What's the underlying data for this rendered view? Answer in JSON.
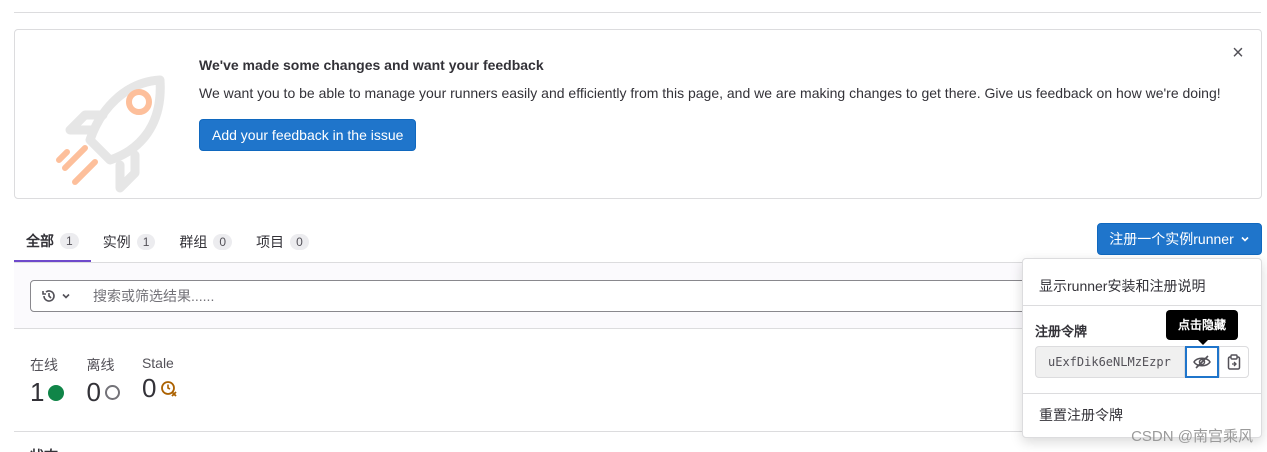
{
  "banner": {
    "title": "We've made some changes and want your feedback",
    "body": "We want you to be able to manage your runners easily and efficiently from this page, and we are making changes to get there. Give us feedback on how we're doing!",
    "button_label": "Add your feedback in the issue",
    "close_glyph": "×"
  },
  "tabs": [
    {
      "label": "全部",
      "count": "1"
    },
    {
      "label": "实例",
      "count": "1"
    },
    {
      "label": "群组",
      "count": "0"
    },
    {
      "label": "项目",
      "count": "0"
    }
  ],
  "register_button": {
    "label": "注册一个实例runner"
  },
  "search": {
    "placeholder": "搜索或筛选结果......"
  },
  "stats": [
    {
      "label": "在线",
      "value": "1"
    },
    {
      "label": "离线",
      "value": "0"
    },
    {
      "label": "Stale",
      "value": "0"
    }
  ],
  "dropdown": {
    "show_instructions": "显示runner安装和注册说明",
    "token_label": "注册令牌",
    "token_value": "uExfDik6eNLMzEzpr",
    "tooltip": "点击隐藏",
    "reset_token": "重置注册令牌"
  },
  "bottom_partial": "状态",
  "watermark": "CSDN @南宫乘风",
  "colors": {
    "primary": "#1f75cb",
    "online": "#108548",
    "stale": "#ab6100",
    "rocket_accent": "#fdbf9b"
  },
  "icons": [
    "close-icon",
    "rocket-illustration",
    "history-icon",
    "chevron-down-icon",
    "eye-slash-icon",
    "clipboard-icon",
    "clock-x-icon"
  ]
}
